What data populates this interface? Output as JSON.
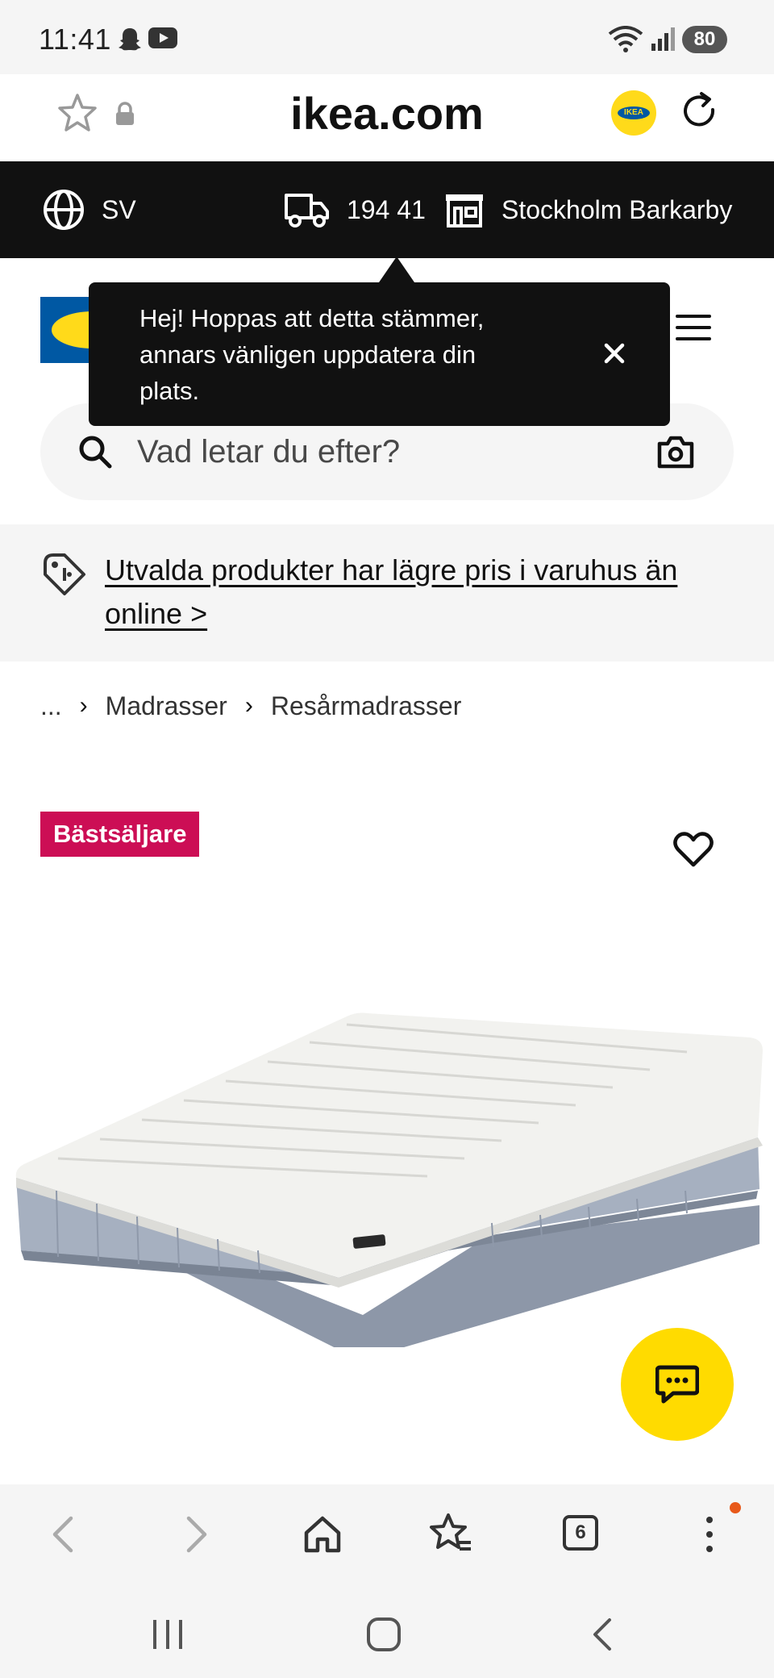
{
  "status_bar": {
    "time": "11:41",
    "battery": "80",
    "icons": [
      "snapchat-icon",
      "youtube-icon",
      "wifi-icon",
      "signal-icon",
      "battery-icon"
    ]
  },
  "url_bar": {
    "url": "ikea.com",
    "icons": [
      "star-icon",
      "lock-icon",
      "ikea-app-icon",
      "reload-icon"
    ]
  },
  "location_bar": {
    "language": "SV",
    "postcode": "194 41",
    "store": "Stockholm Barkarby"
  },
  "tooltip": {
    "text": "Hej! Hoppas att detta stämmer, annars vänligen uppdatera din plats."
  },
  "search": {
    "placeholder": "Vad letar du efter?"
  },
  "promo": {
    "text": "Utvalda produkter har lägre pris i varuhus än online >"
  },
  "breadcrumb": {
    "items": [
      "...",
      "Madrasser",
      "Resårmadrasser"
    ]
  },
  "product": {
    "badge": "Bästsäljare",
    "image_label": "IKEA"
  },
  "browser_nav": {
    "tab_count": "6"
  },
  "colors": {
    "ikea_blue": "#0058a3",
    "ikea_yellow": "#ffda1a",
    "bestseller_red": "#cc0e55",
    "bar_black": "#111111"
  }
}
